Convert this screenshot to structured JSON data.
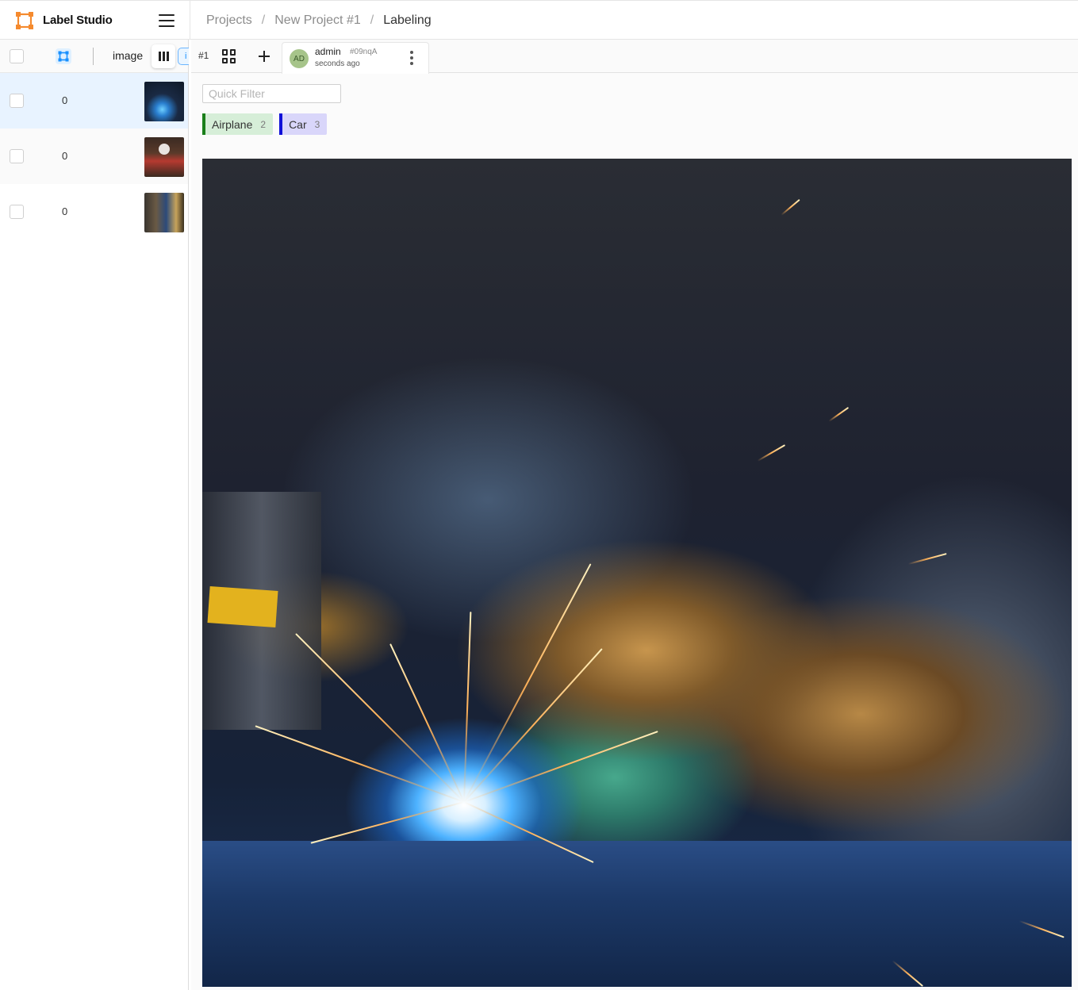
{
  "app": {
    "name": "Label Studio",
    "accent": "#F58A2E"
  },
  "breadcrumb": {
    "items": [
      "Projects",
      "New Project #1",
      "Labeling"
    ],
    "separator": "/"
  },
  "task_list": {
    "columns": {
      "image": "image",
      "annotations_icon": "annotations-icon",
      "partial_button_text": "i"
    },
    "rows": [
      {
        "annotations": "0",
        "selected": true
      },
      {
        "annotations": "0",
        "selected": false
      },
      {
        "annotations": "0",
        "selected": false
      }
    ]
  },
  "editor": {
    "task_id": "#1",
    "annotation": {
      "avatar_initials": "AD",
      "user": "admin",
      "hash": "#09nqA",
      "time": "seconds ago"
    },
    "quick_filter": {
      "placeholder": "Quick Filter",
      "value": ""
    },
    "labels": [
      {
        "name": "Airplane",
        "count": "2",
        "color": "#1a7f1a"
      },
      {
        "name": "Car",
        "count": "3",
        "color": "#1010d8"
      }
    ]
  }
}
